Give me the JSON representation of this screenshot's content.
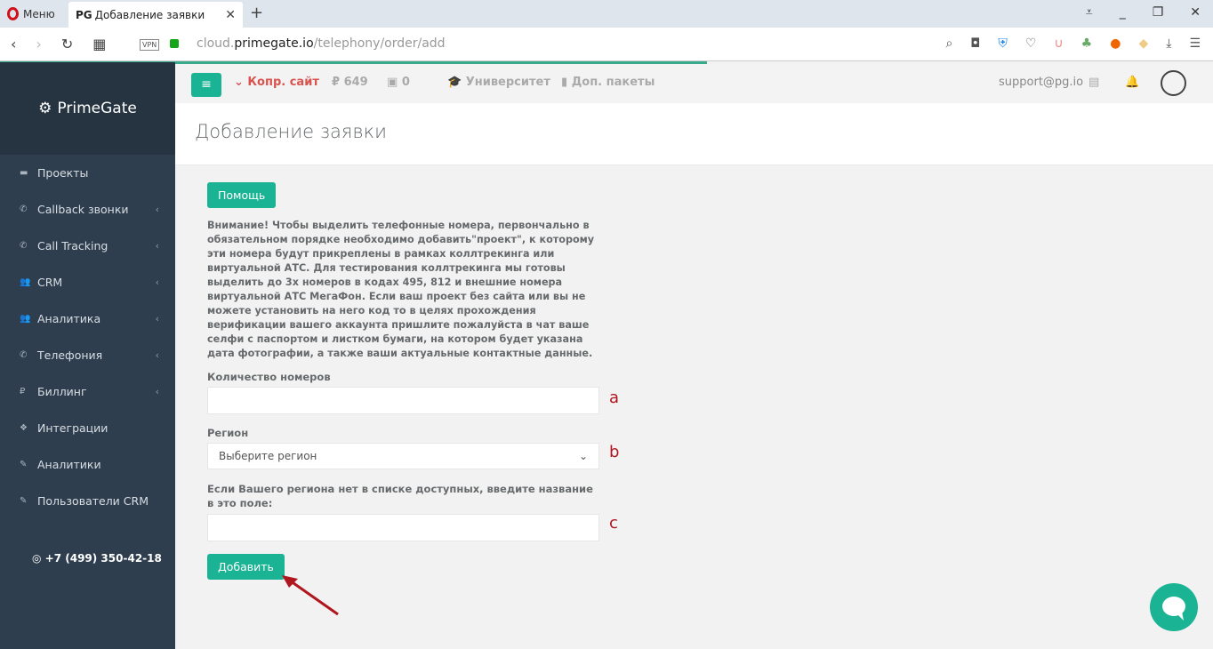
{
  "browser": {
    "menu_label": "Меню",
    "tab_prefix": "PG",
    "tab_title": "Добавление заявки",
    "vpn": "VPN",
    "url_host_pre": "cloud.",
    "url_host": "primegate.io",
    "url_path": "/telephony/order/add"
  },
  "sidebar": {
    "logo": "PrimeGate",
    "items": [
      {
        "label": "Проекты",
        "icon": "briefcase-icon",
        "sub": false
      },
      {
        "label": "Callback звонки",
        "icon": "phone-volume-icon",
        "sub": true
      },
      {
        "label": "Call Tracking",
        "icon": "phone-volume-icon",
        "sub": true
      },
      {
        "label": "CRM",
        "icon": "users-icon",
        "sub": true
      },
      {
        "label": "Аналитика",
        "icon": "users-icon",
        "sub": true
      },
      {
        "label": "Телефония",
        "icon": "phone-icon",
        "sub": true
      },
      {
        "label": "Биллинг",
        "icon": "ruble-icon",
        "sub": true
      },
      {
        "label": "Интеграции",
        "icon": "cubes-icon",
        "sub": false
      },
      {
        "label": "Аналитики",
        "icon": "paperclip-icon",
        "sub": false
      },
      {
        "label": "Пользователи CRM",
        "icon": "paperclip-icon",
        "sub": false
      }
    ],
    "phone": "+7 (499) 350-42-18"
  },
  "topbar": {
    "project": "Копр. сайт",
    "balance": "649",
    "bonus": "0",
    "university": "Университет",
    "packages": "Доп. пакеты",
    "email": "support@pg.io"
  },
  "page": {
    "title": "Добавление заявки",
    "help": "Помощь",
    "warning": "Внимание! Чтобы выделить телефонные номера, первончально в обязательном порядке необходимо добавить\"проект\", к которому эти номера будут прикреплены в рамках коллтрекинга или виртуальной АТС. Для тестирования коллтрекинга мы готовы выделить до 3х номеров в кодах 495, 812 и внешние номера виртуальной АТС МегаФон. Если ваш проект без сайта или вы не можете установить на него код то в целях прохождения верификации вашего аккаунта пришлите пожалуйста в чат ваше селфи с паспортом и листком бумаги, на котором будет указана дата фотографии, а также ваши актуальные контактные данные.",
    "qty_label": "Количество номеров",
    "qty_value": "",
    "region_label": "Регион",
    "region_value": "Выберите регион",
    "custom_label": "Если Вашего региона нет в списке доступных, введите название в это поле:",
    "custom_value": "",
    "submit": "Добавить",
    "marks": [
      "a",
      "b",
      "c"
    ]
  }
}
